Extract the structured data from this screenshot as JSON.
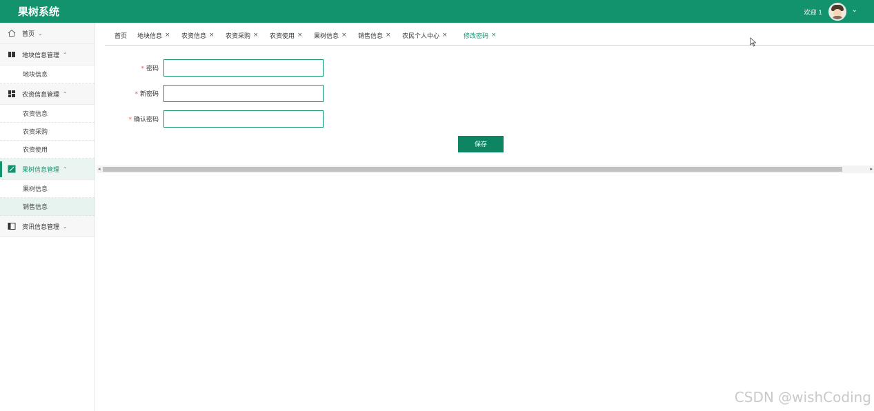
{
  "header": {
    "app_title": "果树系统",
    "welcome": "欢迎 1",
    "chevron": "⌄",
    "brand_color": "#12936e"
  },
  "sidebar": {
    "groups": [
      {
        "label": "首页",
        "icon": "home-icon",
        "chevron": "⌄",
        "items": []
      },
      {
        "label": "地块信息管理",
        "icon": "book-icon",
        "chevron": "⌃",
        "items": [
          "地块信息"
        ]
      },
      {
        "label": "农资信息管理",
        "icon": "grid-icon",
        "chevron": "⌃",
        "items": [
          "农资信息",
          "农资采购",
          "农资使用"
        ]
      },
      {
        "label": "果树信息管理",
        "icon": "image-icon",
        "chevron": "⌃",
        "active": true,
        "items": [
          "果树信息",
          "销售信息"
        ],
        "selected_item": "销售信息"
      },
      {
        "label": "资讯信息管理",
        "icon": "panel-icon",
        "chevron": "⌄",
        "items": []
      }
    ]
  },
  "tabs": [
    {
      "label": "首页",
      "closable": false
    },
    {
      "label": "地块信息",
      "closable": true
    },
    {
      "label": "农资信息",
      "closable": true
    },
    {
      "label": "农资采购",
      "closable": true
    },
    {
      "label": "农资使用",
      "closable": true
    },
    {
      "label": "果树信息",
      "closable": true
    },
    {
      "label": "销售信息",
      "closable": true
    },
    {
      "label": "农民个人中心",
      "closable": true
    },
    {
      "label": "修改密码",
      "closable": true,
      "active": true
    }
  ],
  "tab_close_glyph": "×",
  "form": {
    "fields": [
      {
        "label": "密码",
        "required_mark": "*",
        "value": ""
      },
      {
        "label": "新密码",
        "required_mark": "*",
        "value": ""
      },
      {
        "label": "确认密码",
        "required_mark": "*",
        "value": ""
      }
    ],
    "save_label": "保存"
  },
  "scrollbar": {
    "left_arrow": "◂",
    "right_arrow": "▸"
  },
  "watermark": "CSDN @wishCoding"
}
